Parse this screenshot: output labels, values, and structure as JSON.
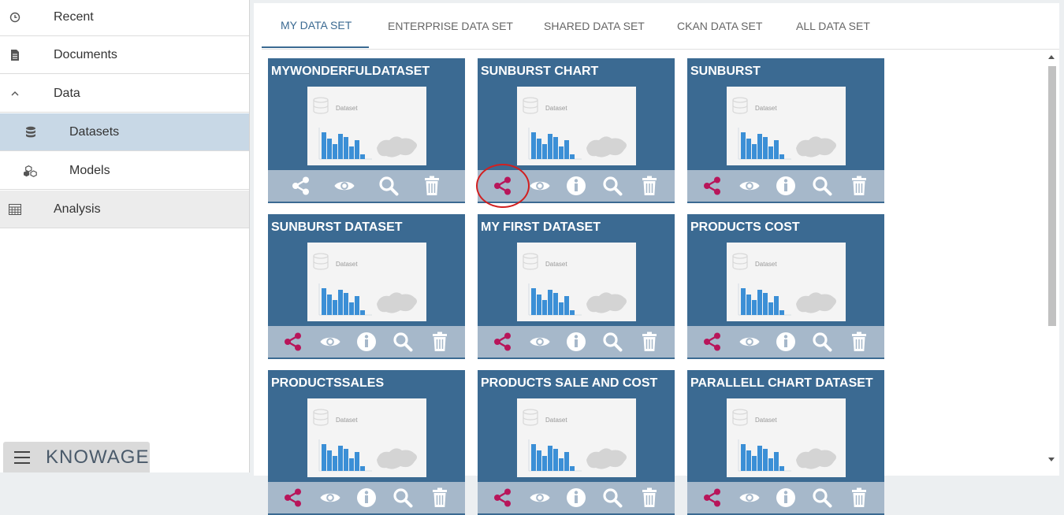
{
  "sidebar": {
    "items": [
      {
        "label": "Recent",
        "icon": "clock-icon"
      },
      {
        "label": "Documents",
        "icon": "document-icon"
      },
      {
        "label": "Data",
        "icon": "chevron-up-icon"
      },
      {
        "label": "Datasets",
        "icon": "database-icon"
      },
      {
        "label": "Models",
        "icon": "cubes-icon"
      },
      {
        "label": "Analysis",
        "icon": "calculator-icon"
      }
    ],
    "brand": "KNOWAGE"
  },
  "tabs": [
    "MY DATA SET",
    "ENTERPRISE DATA SET",
    "SHARED DATA SET",
    "CKAN DATA SET",
    "ALL DATA SET"
  ],
  "active_tab": "MY DATA SET",
  "thumbnail_label": "Dataset",
  "cards": [
    {
      "title": "MYWONDERFULDATASET"
    },
    {
      "title": "SUNBURST CHART"
    },
    {
      "title": "SUNBURST"
    },
    {
      "title": "SUNBURST DATASET"
    },
    {
      "title": "MY FIRST DATASET"
    },
    {
      "title": "PRODUCTS COST"
    },
    {
      "title": "PRODUCTSSALES"
    },
    {
      "title": "PRODUCTS SALE AND COST"
    },
    {
      "title": "PARALLELL CHART DATASET"
    }
  ],
  "colors": {
    "card": "#3b6a92",
    "action_bar": "#a6b8ca",
    "share_shared": "#b8155a",
    "share_unshared": "#ffffff",
    "highlight": "#d21f1f"
  }
}
